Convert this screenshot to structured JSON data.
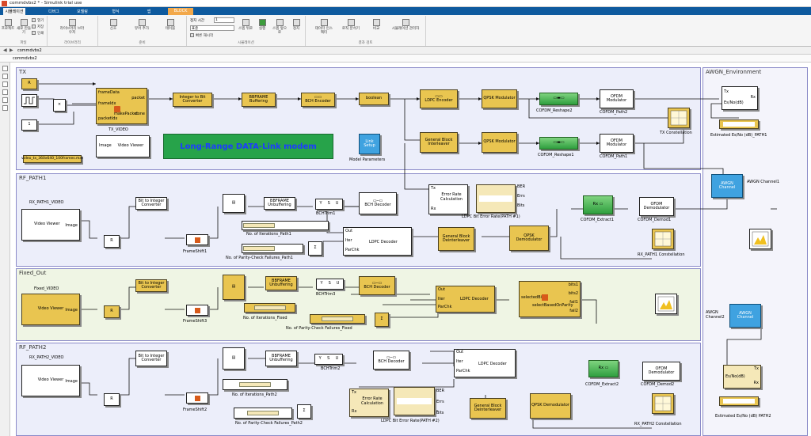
{
  "window": {
    "title": "commdvbs2 * - Simulink trial use"
  },
  "tabs": [
    {
      "label": "시뮬레이션"
    },
    {
      "label": "디버그"
    },
    {
      "label": "모델링"
    },
    {
      "label": "형식"
    },
    {
      "label": "앱"
    },
    {
      "label": "BLOCK"
    }
  ],
  "ribbon": {
    "file": {
      "open": "열기",
      "save": "저장",
      "print": "인쇄",
      "new": "새로 만들기",
      "group": "파일",
      "browse": "프로젝트"
    },
    "library": {
      "library_browser": "라이브러리 브라우저",
      "group": "라이브러리"
    },
    "prepare": {
      "signal": "신호",
      "add_viewer": "뷰어 추가",
      "table": "테이블",
      "group": "준비"
    },
    "simulate": {
      "stop_time_label": "정지 시간",
      "stop_time": "1",
      "mode": "표준",
      "fast_restart": "빠른 재시작",
      "step_back": "스텝 뒤로",
      "run": "실행",
      "step_forward": "스텝 앞으로",
      "stop": "정지",
      "group": "시뮬레이션"
    },
    "review": {
      "inspector": "데이터 인스펙터",
      "logic": "로직 분석기",
      "compare": "비교",
      "cmp": "시뮬레이션 관리자",
      "group": "결과 검토"
    }
  },
  "address": {
    "path": "commdvbs2"
  },
  "breadcrumb": {
    "root": "commdvbs2"
  },
  "areas": {
    "tx": "TX",
    "awgn": "AWGN_Environment",
    "rf1": "RF_PATH1",
    "fixed": "Fixed_Out",
    "rf2": "RF_PATH2"
  },
  "tx": {
    "video_source": "video_tx_360x640_100frames.mat",
    "make_packet": {
      "in1": "frameData",
      "in2": "frameIdx",
      "in3": "packetIdx",
      "out1": "packet",
      "out2": "done",
      "name": "makePacket"
    },
    "int2bit": "Integer to Bit Converter",
    "bbframe": "BBFRAME Buffering",
    "bch": "BCH Encoder",
    "boolean": "boolean",
    "ldpc": "LDPC Encoder",
    "qpsk1": "QPSK Modulator",
    "ofdm2": "OFDM Modulator",
    "ofdm2_cap": "COFDM_Path2",
    "reshape2": "COFDM_Reshape2",
    "interleaver": "General Block Interleaver",
    "qpsk2": "QPSK Modulator",
    "reshape1": "COFDM_Reshape1",
    "ofdm1": "OFDM Modulator",
    "ofdm1_cap": "COFDM_Path1",
    "constellation": "TX Constellation",
    "viewer": {
      "port": "Image",
      "label": "Video Viewer",
      "cap": "TX_VIDEO"
    },
    "banner": "Long-Range  DATA-Link modem",
    "link": {
      "label": "Link Setup",
      "cap": "Model Parameters"
    },
    "const_r": "R",
    "const_1": "1"
  },
  "awgn": {
    "ebno": {
      "in": "Tx",
      "out1": "Rx",
      "out2": "Es/No(dB)"
    },
    "est1": "Estimated Es/No (dB)_PATH1",
    "ch1": "AWGN Channel",
    "ch1_cap": "AWGN Channel1",
    "ch2": "AWGN Channel",
    "ch2_cap": "AWGN Channel2",
    "ebno2": {
      "out1": "Tx",
      "out2": "Es/No(dB)",
      "out3": "Rx"
    },
    "est2": "Estimated Es/No (dB) PATH2"
  },
  "rf1": {
    "video_cap": "RX_PATH1_VIDEO",
    "viewer": {
      "port": "Image",
      "label": "Video Viewer"
    },
    "bit2int": "Bit to Integer Converter",
    "r": "R",
    "frameshift": "FrameShift1",
    "unbuffer": "BBFRAME Unbuffering",
    "bchtrim": "BCHTrim1",
    "ysu": [
      "Y",
      "S",
      "U"
    ],
    "bchdec": "BCH Decoder",
    "err": {
      "tx": "Tx",
      "rx": "Rx",
      "label": "Error Rate Calculation"
    },
    "ber": {
      "cap": "LDPC Bit Error Rate(PATH #1)",
      "r1": "BER",
      "r2": "Errs",
      "r3": "Bits"
    },
    "extract": "COFDM_Extract1",
    "ofdmd": "OFDM Demodulator",
    "ofdmd_cap": "COFDM_Demod1",
    "iter": "No. of Iterations_Path1",
    "parity": "No. of Parity-Check Failures_Path1",
    "ldpcdec": {
      "out": "Out",
      "iter": "Iter",
      "par": "ParChk",
      "label": "LDPC Decoder"
    },
    "deint": "General Block Deinterleaver",
    "qpskd": "QPSK Demodulator",
    "const": "RX_PATH1 Constellation"
  },
  "fixed": {
    "video_cap": "Fixed_VIDEO",
    "viewer": {
      "port": "Image",
      "label": "Video Viewer"
    },
    "bit2int": "Bit to Integer Converter",
    "r": "R",
    "frameshift": "FrameShift3",
    "unbuffer": "BBFRAME Unbuffering",
    "bchtrim": "BCHTrim3",
    "ysu": [
      "Y",
      "S",
      "U"
    ],
    "bchdec": "BCH Decoder",
    "iter": "No. of Iterations_Fixed",
    "parity": "No. of Parity-Check Failures_Fixed",
    "ldpcdec": {
      "out": "Out",
      "iter": "Iter",
      "par": "ParChk",
      "label": "LDPC Decoder"
    },
    "select": {
      "in": "selectedBits",
      "label": "selectBasedOnParity",
      "o1": "bits1",
      "o2": "bits2",
      "o3": "fail1",
      "o4": "fail2"
    }
  },
  "rf2": {
    "video_cap": "RX_PATH2_VIDEO",
    "viewer": {
      "port": "Image",
      "label": "Video Viewer"
    },
    "bit2int": "Bit to Integer Converter",
    "r": "R",
    "frameshift": "FrameShift2",
    "unbuffer": "BBFRAME Unbuffering",
    "bchtrim": "BCHTrim2",
    "ysu": [
      "Y",
      "S",
      "U"
    ],
    "bchdec": "BCH Decoder",
    "ldpcdec": {
      "out": "Out",
      "iter": "Iter",
      "par": "ParChk",
      "label": "LDPC Decoder"
    },
    "extract": "COFDM_Extract2",
    "ofdmd": "OFDM Demodulator",
    "ofdmd_cap": "COFDM_Demod2",
    "iter": "No. of Iterations_Path2",
    "parity": "No. of Parity-Check Failures_Path2",
    "err": {
      "tx": "Tx",
      "rx": "Rx",
      "label": "Error Rate Calculation"
    },
    "ber": {
      "cap": "LDPC Bit Error Rate(PATH #2)",
      "r1": "BER",
      "r2": "Errs",
      "r3": "Bits"
    },
    "deint": "General Block Deinterleaver",
    "qpskd": "QPSK Demodulator",
    "const": "RX_PATH2 Constellation"
  }
}
